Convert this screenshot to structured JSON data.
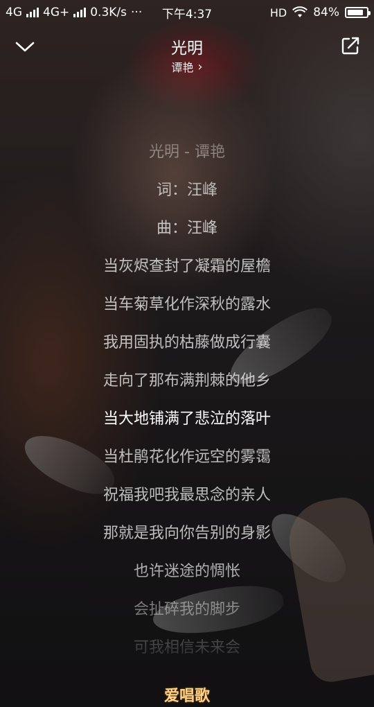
{
  "status_bar": {
    "net1": "4G",
    "net2": "4G+",
    "speed": "0.3K/s",
    "more": "···",
    "time": "下午4:37",
    "hd": "HD",
    "battery_text": "84%",
    "battery_level": 0.84
  },
  "header": {
    "title": "光明",
    "artist": "谭艳",
    "artist_chevron": "›"
  },
  "icons": {
    "back": "chevron-down-icon",
    "share": "share-icon"
  },
  "lyrics": {
    "current_index": 7,
    "lines": [
      "光明 - 谭艳",
      "词：汪峰",
      "曲：汪峰",
      "当灰烬查封了凝霜的屋檐",
      "当车菊草化作深秋的露水",
      "我用固执的枯藤做成行囊",
      "走向了那布满荆棘的他乡",
      "当大地铺满了悲泣的落叶",
      "当杜鹃花化作远空的雾霭",
      "祝福我吧我最思念的亲人",
      "那就是我向你告别的身影",
      "也许迷途的惆怅",
      "会扯碎我的脚步",
      "可我相信未来会"
    ]
  },
  "watermark": "爱唱歌",
  "colors": {
    "text": "#ffffff",
    "dim_text": "rgba(255,255,255,0.72)",
    "watermark": "#ffd28a"
  }
}
